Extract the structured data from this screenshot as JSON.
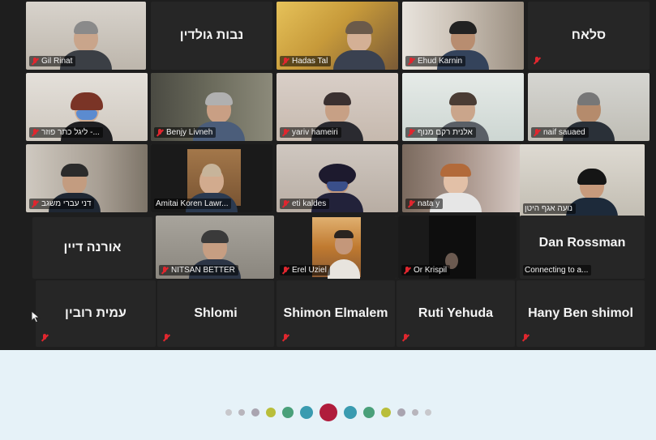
{
  "participants_row1": [
    "Gil Rinat",
    "נבות גולדין",
    "Hadas Tal",
    "Ehud Karnin",
    "סלאח"
  ],
  "participants_row2": [
    "ליגל כתר פוזר -...",
    "Benjy Livneh",
    "yariv hameiri",
    "אלנית רקם מנוף",
    "naif sauaed"
  ],
  "participants_row3": [
    "דני עברי משגב",
    "Amitai Koren Lawr...",
    "eti kaldes",
    "nata y",
    "נועה אגף היטן"
  ],
  "participants_row4": [
    "אורנה דיין",
    "NITSAN BETTER",
    "Erel Uziel",
    "Or Krispil",
    "Dan Rossman"
  ],
  "participants_row5": [
    "עמית רובין",
    "Shlomi",
    "Shimon Elmalem",
    "Ruti Yehuda",
    "Hany Ben shimol"
  ],
  "connecting_text": "Connecting to a...",
  "icons": {
    "mic_muted": "muted-microphone-icon",
    "cursor": "mouse-pointer-icon"
  },
  "carousel": {
    "dots": [
      {
        "color": "#c8c8cc"
      },
      {
        "color": "#b8b5bc"
      },
      {
        "color": "#a9a4b0"
      },
      {
        "color": "#b9be3a"
      },
      {
        "color": "#4aa07a"
      },
      {
        "color": "#3a9bb0"
      },
      {
        "color": "#b01c3c",
        "active": true
      },
      {
        "color": "#3a9bb0"
      },
      {
        "color": "#4aa07a"
      },
      {
        "color": "#b9be3a"
      },
      {
        "color": "#a9a4b0"
      },
      {
        "color": "#b8b5bc"
      },
      {
        "color": "#c8c8cc"
      }
    ]
  }
}
